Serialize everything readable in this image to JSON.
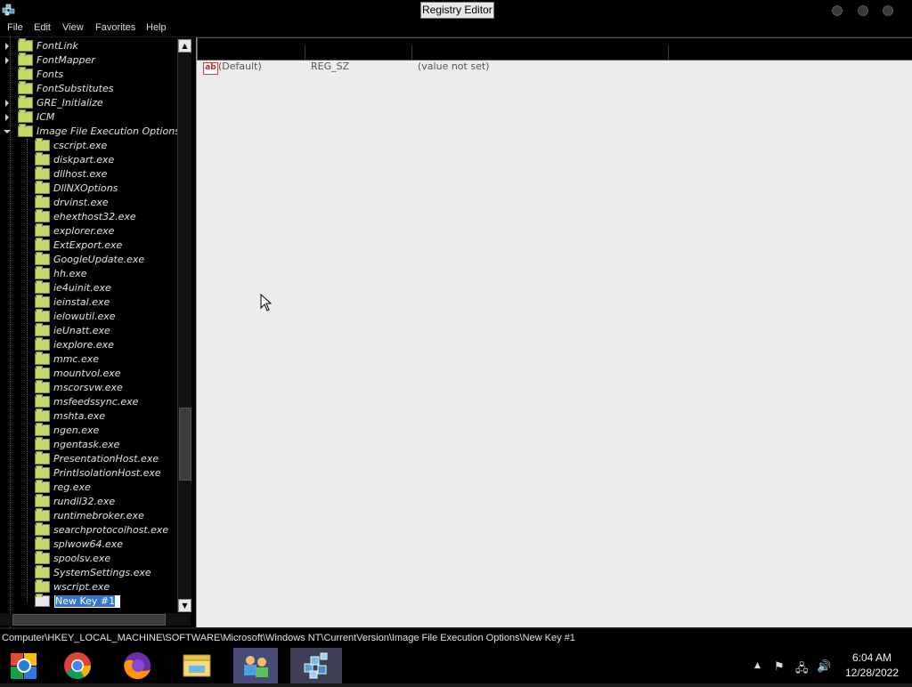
{
  "window": {
    "title": "Registry Editor"
  },
  "menu": [
    "File",
    "Edit",
    "View",
    "Favorites",
    "Help"
  ],
  "tree": {
    "top_items": [
      {
        "label": "FontLink",
        "expandable": true
      },
      {
        "label": "FontMapper",
        "expandable": true
      },
      {
        "label": "Fonts",
        "expandable": false
      },
      {
        "label": "FontSubstitutes",
        "expandable": false
      },
      {
        "label": "GRE_Initialize",
        "expandable": true
      },
      {
        "label": "ICM",
        "expandable": true
      },
      {
        "label": "Image File Execution Options",
        "expandable": true,
        "expanded": true
      }
    ],
    "children": [
      "cscript.exe",
      "diskpart.exe",
      "dllhost.exe",
      "DllNXOptions",
      "drvinst.exe",
      "ehexthost32.exe",
      "explorer.exe",
      "ExtExport.exe",
      "GoogleUpdate.exe",
      "hh.exe",
      "ie4uinit.exe",
      "ieinstal.exe",
      "ielowutil.exe",
      "ieUnatt.exe",
      "iexplore.exe",
      "mmc.exe",
      "mountvol.exe",
      "mscorsvw.exe",
      "msfeedssync.exe",
      "mshta.exe",
      "ngen.exe",
      "ngentask.exe",
      "PresentationHost.exe",
      "PrintIsolationHost.exe",
      "reg.exe",
      "rundll32.exe",
      "runtimebroker.exe",
      "searchprotocolhost.exe",
      "splwow64.exe",
      "spoolsv.exe",
      "SystemSettings.exe",
      "wscript.exe"
    ],
    "renaming_item": "New Key #1"
  },
  "values_list": {
    "rows": [
      {
        "name": "(Default)",
        "type": "REG_SZ",
        "data": "(value not set)",
        "icon": "string-value-icon"
      }
    ]
  },
  "status_bar": {
    "path": "Computer\\HKEY_LOCAL_MACHINE\\SOFTWARE\\Microsoft\\Windows NT\\CurrentVersion\\Image File Execution Options\\New Key #1"
  },
  "taskbar": {
    "apps": [
      {
        "name": "chrome-tiles-icon"
      },
      {
        "name": "chrome-icon"
      },
      {
        "name": "firefox-icon"
      },
      {
        "name": "file-explorer-icon"
      },
      {
        "name": "control-panel-icon"
      },
      {
        "name": "regedit-icon",
        "active": true
      }
    ],
    "time": "6:04 AM",
    "date": "12/28/2022"
  }
}
